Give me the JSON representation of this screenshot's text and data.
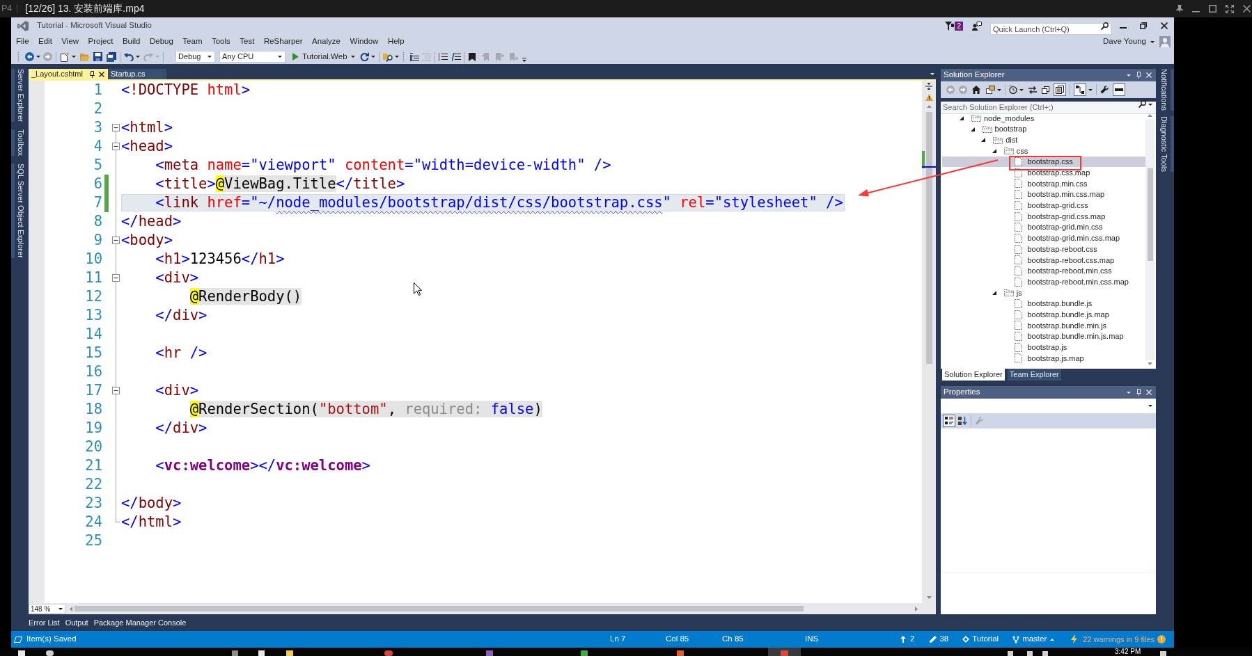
{
  "player": {
    "prefix": "P4",
    "title": "[12/26] 13. 安装前端库.mp4"
  },
  "window": {
    "title": "Tutorial - Microsoft Visual Studio",
    "notification_badge": "2",
    "quick_launch": {
      "placeholder": "Quick Launch (Ctrl+Q)"
    },
    "user": "Dave Young"
  },
  "menu": [
    "File",
    "Edit",
    "View",
    "Project",
    "Build",
    "Debug",
    "Team",
    "Tools",
    "Test",
    "ReSharper",
    "Analyze",
    "Window",
    "Help"
  ],
  "toolbar": {
    "configuration": "Debug",
    "platform": "Any CPU",
    "start_target": "Tutorial.Web"
  },
  "left_tabs": [
    "Server Explorer",
    "Toolbox",
    "SQL Server Object Explorer"
  ],
  "document_tabs": [
    {
      "label": "_Layout.cshtml",
      "selected": true
    },
    {
      "label": "Startup.cs",
      "selected": false
    }
  ],
  "editor": {
    "lines": [
      {
        "number": "1",
        "fold_marker": false,
        "changed": false,
        "current": false,
        "tokens": [
          {
            "kind": "delim",
            "text": "<"
          },
          {
            "kind": "tag",
            "text": "!DOCTYPE"
          },
          {
            "kind": "attr",
            "text": " html"
          },
          {
            "kind": "delim",
            "text": ">"
          }
        ]
      },
      {
        "number": "2",
        "fold_marker": false,
        "changed": false,
        "current": false
      },
      {
        "number": "3",
        "fold_marker": true,
        "changed": false,
        "current": false,
        "tokens": [
          {
            "kind": "delim",
            "text": "<"
          },
          {
            "kind": "tag",
            "text": "html"
          },
          {
            "kind": "delim",
            "text": ">"
          }
        ]
      },
      {
        "number": "4",
        "fold_marker": true,
        "changed": false,
        "current": false,
        "tokens": [
          {
            "kind": "delim",
            "text": "<"
          },
          {
            "kind": "tag",
            "text": "head"
          },
          {
            "kind": "delim",
            "text": ">"
          }
        ]
      },
      {
        "number": "5",
        "fold_marker": false,
        "changed": false,
        "current": false,
        "tokens": [
          {
            "kind": "delim",
            "text": "    <"
          },
          {
            "kind": "tag",
            "text": "meta"
          },
          {
            "kind": "attr",
            "text": " name"
          },
          {
            "kind": "delim",
            "text": "="
          },
          {
            "kind": "value",
            "text": "\"viewport\""
          },
          {
            "kind": "attr",
            "text": " content"
          },
          {
            "kind": "delim",
            "text": "="
          },
          {
            "kind": "value",
            "text": "\"width=device-width\""
          },
          {
            "kind": "delim",
            "text": " />"
          }
        ]
      },
      {
        "number": "6",
        "fold_marker": false,
        "changed": true,
        "current": false,
        "tokens": [
          {
            "kind": "delim",
            "text": "    <"
          },
          {
            "kind": "tag",
            "text": "title"
          },
          {
            "kind": "delim",
            "text": ">"
          },
          {
            "kind": "razor_at",
            "text": "@"
          },
          {
            "kind": "razor",
            "text": "ViewBag.Title"
          },
          {
            "kind": "delim",
            "text": "</"
          },
          {
            "kind": "tag",
            "text": "title"
          },
          {
            "kind": "delim",
            "text": ">"
          }
        ]
      },
      {
        "number": "7",
        "fold_marker": false,
        "changed": true,
        "current": true,
        "tokens": [
          {
            "kind": "delim",
            "text": "    <"
          },
          {
            "kind": "tag",
            "text": "link"
          },
          {
            "kind": "attr",
            "text": " href"
          },
          {
            "kind": "delim",
            "text": "="
          },
          {
            "kind": "value",
            "text": "\"~/"
          },
          {
            "kind": "path",
            "text": "node_modules/bootstrap/dist/css/bootstrap.css"
          },
          {
            "kind": "value",
            "text": "\""
          },
          {
            "kind": "attr",
            "text": " rel"
          },
          {
            "kind": "delim",
            "text": "="
          },
          {
            "kind": "value",
            "text": "\"stylesheet\""
          },
          {
            "kind": "delim",
            "text": " />"
          }
        ]
      },
      {
        "number": "8",
        "fold_marker": false,
        "changed": false,
        "current": false,
        "tokens": [
          {
            "kind": "delim",
            "text": "</"
          },
          {
            "kind": "tag",
            "text": "head"
          },
          {
            "kind": "delim",
            "text": ">"
          }
        ]
      },
      {
        "number": "9",
        "fold_marker": true,
        "changed": false,
        "current": false,
        "tokens": [
          {
            "kind": "delim",
            "text": "<"
          },
          {
            "kind": "tag",
            "text": "body"
          },
          {
            "kind": "delim",
            "text": ">"
          }
        ]
      },
      {
        "number": "10",
        "fold_marker": false,
        "changed": false,
        "current": false,
        "tokens": [
          {
            "kind": "delim",
            "text": "    <"
          },
          {
            "kind": "tag",
            "text": "h1"
          },
          {
            "kind": "delim",
            "text": ">"
          },
          {
            "kind": "text",
            "text": "123456"
          },
          {
            "kind": "delim",
            "text": "</"
          },
          {
            "kind": "tag",
            "text": "h1"
          },
          {
            "kind": "delim",
            "text": ">"
          }
        ]
      },
      {
        "number": "11",
        "fold_marker": true,
        "changed": false,
        "current": false,
        "tokens": [
          {
            "kind": "delim",
            "text": "    <"
          },
          {
            "kind": "tag",
            "text": "div"
          },
          {
            "kind": "delim",
            "text": ">"
          }
        ]
      },
      {
        "number": "12",
        "fold_marker": false,
        "changed": false,
        "current": false,
        "tokens": [
          {
            "kind": "razor_at",
            "text": "        @"
          },
          {
            "kind": "razor",
            "text": "RenderBody()"
          }
        ]
      },
      {
        "number": "13",
        "fold_marker": false,
        "changed": false,
        "current": false,
        "tokens": [
          {
            "kind": "delim",
            "text": "    </"
          },
          {
            "kind": "tag",
            "text": "div"
          },
          {
            "kind": "delim",
            "text": ">"
          }
        ]
      },
      {
        "number": "14",
        "fold_marker": false,
        "changed": false,
        "current": false
      },
      {
        "number": "15",
        "fold_marker": false,
        "changed": false,
        "current": false,
        "tokens": [
          {
            "kind": "delim",
            "text": "    <"
          },
          {
            "kind": "tag",
            "text": "hr"
          },
          {
            "kind": "delim",
            "text": " />"
          }
        ]
      },
      {
        "number": "16",
        "fold_marker": false,
        "changed": false,
        "current": false
      },
      {
        "number": "17",
        "fold_marker": true,
        "changed": false,
        "current": false,
        "tokens": [
          {
            "kind": "delim",
            "text": "    <"
          },
          {
            "kind": "tag",
            "text": "div"
          },
          {
            "kind": "delim",
            "text": ">"
          }
        ]
      },
      {
        "number": "18",
        "fold_marker": false,
        "changed": false,
        "current": false,
        "tokens": [
          {
            "kind": "razor_at",
            "text": "        @"
          },
          {
            "kind": "razor",
            "text": "RenderSection("
          },
          {
            "kind": "razor_string",
            "text": "\"bottom\""
          },
          {
            "kind": "razor",
            "text": ", "
          },
          {
            "kind": "razor_hint",
            "text": "required:"
          },
          {
            "kind": "razor_keyword",
            "text": " false"
          },
          {
            "kind": "razor",
            "text": ")"
          }
        ]
      },
      {
        "number": "19",
        "fold_marker": false,
        "changed": false,
        "current": false,
        "tokens": [
          {
            "kind": "delim",
            "text": "    </"
          },
          {
            "kind": "tag",
            "text": "div"
          },
          {
            "kind": "delim",
            "text": ">"
          }
        ]
      },
      {
        "number": "20",
        "fold_marker": false,
        "changed": false,
        "current": false
      },
      {
        "number": "21",
        "fold_marker": false,
        "changed": false,
        "current": false,
        "tokens": [
          {
            "kind": "delim",
            "text": "    <"
          },
          {
            "kind": "component",
            "text": "vc:welcome"
          },
          {
            "kind": "delim",
            "text": "></"
          },
          {
            "kind": "component",
            "text": "vc:welcome"
          },
          {
            "kind": "delim",
            "text": ">"
          }
        ]
      },
      {
        "number": "22",
        "fold_marker": false,
        "changed": false,
        "current": false
      },
      {
        "number": "23",
        "fold_marker": false,
        "changed": false,
        "current": false,
        "tokens": [
          {
            "kind": "delim",
            "text": "</"
          },
          {
            "kind": "tag",
            "text": "body"
          },
          {
            "kind": "delim",
            "text": ">"
          }
        ]
      },
      {
        "number": "24",
        "fold_marker": false,
        "changed": false,
        "current": false,
        "tokens": [
          {
            "kind": "delim",
            "text": "</"
          },
          {
            "kind": "tag",
            "text": "html"
          },
          {
            "kind": "delim",
            "text": ">"
          }
        ]
      },
      {
        "number": "25",
        "fold_marker": false,
        "changed": false,
        "current": false
      }
    ],
    "zoom": "148 %"
  },
  "solution_explorer": {
    "title": "Solution Explorer",
    "search": {
      "placeholder": "Search Solution Explorer (Ctrl+;)"
    },
    "tree": [
      {
        "label": "node_modules",
        "kind": "folder",
        "expanded": true,
        "selected": false,
        "children": [
          {
            "label": "bootstrap",
            "kind": "folder",
            "expanded": true,
            "selected": false,
            "children": [
              {
                "label": "dist",
                "kind": "folder",
                "expanded": true,
                "selected": false,
                "children": [
                  {
                    "label": "css",
                    "kind": "folder",
                    "expanded": true,
                    "selected": false,
                    "children": [
                      {
                        "label": "bootstrap.css",
                        "kind": "file",
                        "selected": true
                      },
                      {
                        "label": "bootstrap.css.map",
                        "kind": "file",
                        "selected": false
                      },
                      {
                        "label": "bootstrap.min.css",
                        "kind": "file",
                        "selected": false
                      },
                      {
                        "label": "bootstrap.min.css.map",
                        "kind": "file",
                        "selected": false
                      },
                      {
                        "label": "bootstrap-grid.css",
                        "kind": "file",
                        "selected": false
                      },
                      {
                        "label": "bootstrap-grid.css.map",
                        "kind": "file",
                        "selected": false
                      },
                      {
                        "label": "bootstrap-grid.min.css",
                        "kind": "file",
                        "selected": false
                      },
                      {
                        "label": "bootstrap-grid.min.css.map",
                        "kind": "file",
                        "selected": false
                      },
                      {
                        "label": "bootstrap-reboot.css",
                        "kind": "file",
                        "selected": false
                      },
                      {
                        "label": "bootstrap-reboot.css.map",
                        "kind": "file",
                        "selected": false
                      },
                      {
                        "label": "bootstrap-reboot.min.css",
                        "kind": "file",
                        "selected": false
                      },
                      {
                        "label": "bootstrap-reboot.min.css.map",
                        "kind": "file",
                        "selected": false
                      }
                    ]
                  },
                  {
                    "label": "js",
                    "kind": "folder",
                    "expanded": true,
                    "selected": false,
                    "children": [
                      {
                        "label": "bootstrap.bundle.js",
                        "kind": "file",
                        "selected": false
                      },
                      {
                        "label": "bootstrap.bundle.js.map",
                        "kind": "file",
                        "selected": false
                      },
                      {
                        "label": "bootstrap.bundle.min.js",
                        "kind": "file",
                        "selected": false
                      },
                      {
                        "label": "bootstrap.bundle.min.js.map",
                        "kind": "file",
                        "selected": false
                      },
                      {
                        "label": "bootstrap.js",
                        "kind": "file",
                        "selected": false
                      },
                      {
                        "label": "bootstrap.js.map",
                        "kind": "file",
                        "selected": false
                      }
                    ]
                  }
                ]
              }
            ]
          }
        ]
      }
    ],
    "tabs": [
      {
        "label": "Solution Explorer",
        "selected": true
      },
      {
        "label": "Team Explorer",
        "selected": false
      }
    ]
  },
  "properties": {
    "title": "Properties"
  },
  "right_tabs": [
    "Notifications",
    "Diagnostic Tools"
  ],
  "tool_tabs": [
    "Error List",
    "Output",
    "Package Manager Console"
  ],
  "status_bar": {
    "message": "Item(s) Saved",
    "line": "Ln 7",
    "column": "Col 85",
    "character": "Ch 85",
    "mode": "INS",
    "pending_commits": "2",
    "pending_changes": "38",
    "repository": "Tutorial",
    "branch": "master",
    "warnings": "22 warnings in 9 files"
  },
  "taskbar": {
    "clock": "3:42 PM"
  }
}
